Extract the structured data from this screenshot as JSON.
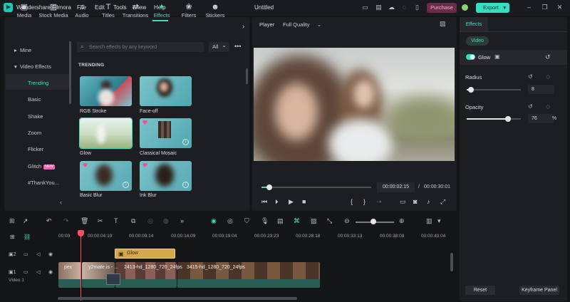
{
  "titlebar": {
    "app_name": "Wondershare Filmora",
    "menu": [
      "File",
      "Edit",
      "Tools",
      "View",
      "Help"
    ],
    "project_title": "Untitled",
    "purchase_label": "Purchase",
    "export_label": "Export"
  },
  "media_toolbar": {
    "items": [
      {
        "label": "Media",
        "icon": "media-icon"
      },
      {
        "label": "Stock Media",
        "icon": "stock-media-icon"
      },
      {
        "label": "Audio",
        "icon": "audio-icon"
      },
      {
        "label": "Titles",
        "icon": "titles-icon"
      },
      {
        "label": "Transitions",
        "icon": "transitions-icon"
      },
      {
        "label": "Effects",
        "icon": "effects-icon",
        "active": true
      },
      {
        "label": "Filters",
        "icon": "filters-icon"
      },
      {
        "label": "Stickers",
        "icon": "stickers-icon"
      }
    ]
  },
  "sidebar": {
    "items": [
      {
        "label": "Mine",
        "level": 0
      },
      {
        "label": "Video Effects",
        "level": 0
      },
      {
        "label": "Trending",
        "level": 1,
        "active": true
      },
      {
        "label": "Basic",
        "level": 1
      },
      {
        "label": "Shake",
        "level": 1
      },
      {
        "label": "Zoom",
        "level": 1
      },
      {
        "label": "Flicker",
        "level": 1
      },
      {
        "label": "Glitch",
        "level": 1,
        "badge": "NEW"
      },
      {
        "label": "#ThankYou...",
        "level": 1
      }
    ]
  },
  "search": {
    "placeholder": "Search effects by any keyword",
    "filter_value": "All"
  },
  "effects_grid": {
    "section_title": "TRENDING",
    "cards": [
      {
        "label": "RGB Stroke"
      },
      {
        "label": "Face-off"
      },
      {
        "label": "Glow",
        "selected": true
      },
      {
        "label": "Classical Mosaic"
      },
      {
        "label": "Basic Blur"
      },
      {
        "label": "Ink Blur"
      }
    ]
  },
  "player": {
    "label": "Player",
    "quality": "Full Quality",
    "current_time": "00:00:02:15",
    "separator": "/",
    "total_time": "00:00:30:01",
    "progress": 0.07
  },
  "effects_panel": {
    "tab_label": "Effects",
    "sub_tab": "Video",
    "effect_name": "Glow",
    "radius_label": "Radius",
    "radius_value": "8",
    "radius_fraction": 0.08,
    "opacity_label": "Opacity",
    "opacity_value": "76",
    "opacity_unit": "%",
    "opacity_fraction": 0.76,
    "reset_label": "Reset",
    "keyframe_label": "Keyframe Panel"
  },
  "timeline": {
    "ruler": [
      "00:00",
      "00:00:04:19",
      "00:00:09:14",
      "00:00:14:09",
      "00:00:19:04",
      "00:00:23:23",
      "00:00:28:18",
      "00:00:33:13",
      "00:00:38:08",
      "00:00:43:04"
    ],
    "effect_track_index": "2",
    "video_track_index": "1",
    "video_track_label": "Video 1",
    "effect_clip_label": "Glow",
    "clips": [
      {
        "label": "pex"
      },
      {
        "label": "y2mate.is - ..."
      },
      {
        "label": "2413-hd_1280_720_24fps"
      },
      {
        "label": "3415-hd_1280_720_24fps"
      }
    ]
  },
  "colors": {
    "accent": "#35e0c1",
    "purchase": "#6b2d45",
    "playhead": "#ff4b6e",
    "effect_clip": "#d3a94a"
  }
}
